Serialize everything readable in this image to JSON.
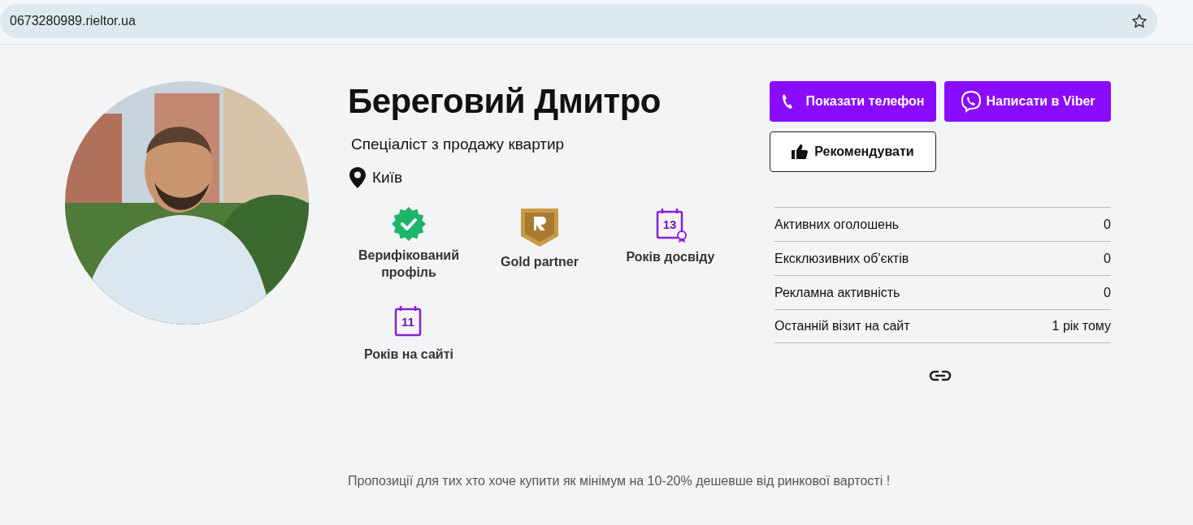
{
  "browser": {
    "url": "0673280989.rieltor.ua"
  },
  "profile": {
    "name": "Береговий Дмитро",
    "role": "Спеціаліст з продажу квартир",
    "city": "Київ"
  },
  "badges": [
    {
      "kind": "verified",
      "label": "Верифікований профіль"
    },
    {
      "kind": "gold",
      "label": "Gold partner"
    },
    {
      "kind": "experience",
      "number": "13",
      "label": "Років досвіду"
    },
    {
      "kind": "site",
      "number": "11",
      "label": "Років на сайті"
    }
  ],
  "buttons": [
    {
      "kind": "phone",
      "label": "Показати телефон"
    },
    {
      "kind": "viber",
      "label": "Написати в Viber"
    },
    {
      "kind": "recommend",
      "label": "Рекомендувати"
    }
  ],
  "stats": [
    {
      "label": "Активних оголошень",
      "value": "0"
    },
    {
      "label": "Ексклюзивних об'єктів",
      "value": "0"
    },
    {
      "label": "Рекламна активність",
      "value": "0"
    },
    {
      "label": "Останній візит на сайт",
      "value": "1 рік тому"
    }
  ],
  "description": "Пропозиції для тих хто хоче купити як мінімум на 10-20% дешевше від ринкової вартості !"
}
